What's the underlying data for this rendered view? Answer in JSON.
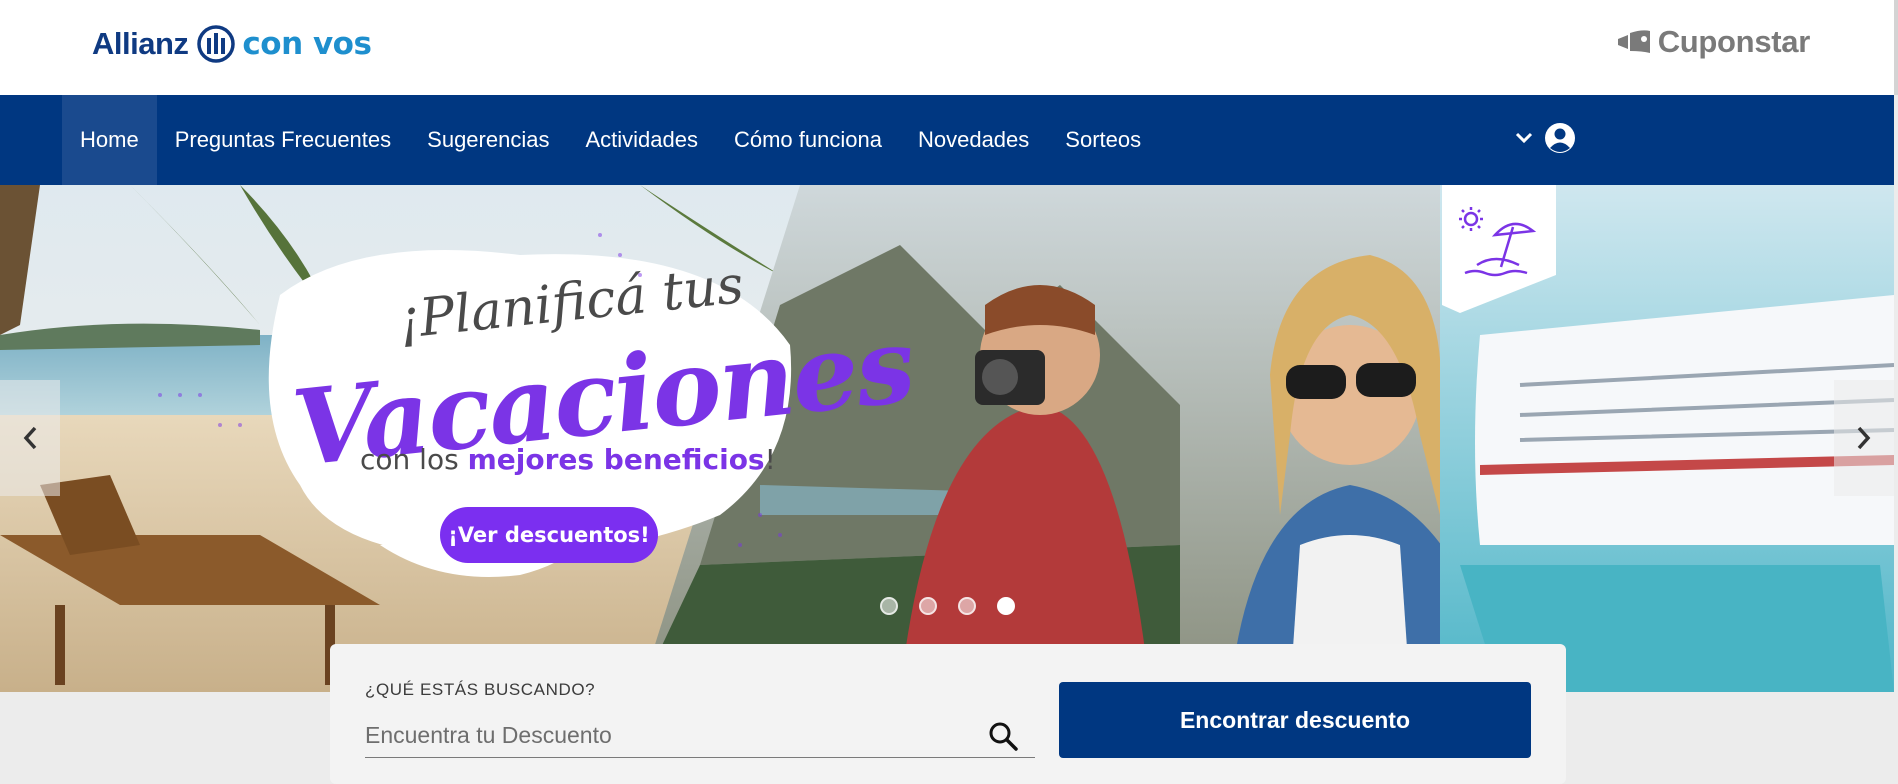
{
  "header": {
    "brand_allianz": "Allianz",
    "brand_convos": "con vos",
    "partner": "Cuponstar"
  },
  "nav": {
    "items": [
      {
        "label": "Home",
        "active": true
      },
      {
        "label": "Preguntas Frecuentes"
      },
      {
        "label": "Sugerencias"
      },
      {
        "label": "Actividades"
      },
      {
        "label": "Cómo funciona"
      },
      {
        "label": "Novedades"
      },
      {
        "label": "Sorteos"
      }
    ],
    "dropdown_icon": "chevron-down-icon",
    "account_icon": "user-circle-icon"
  },
  "hero": {
    "title_line1": "¡Planificá tus",
    "title_line2": "Vacaciones",
    "subtitle_prefix": "con los",
    "subtitle_bold": "mejores beneficios",
    "subtitle_suffix": "!",
    "cta": "¡Ver descuentos!",
    "slides": 4,
    "active_slide": 4,
    "badge_icon": "beach-umbrella-icon"
  },
  "search": {
    "label": "¿QUÉ ESTÁS BUSCANDO?",
    "placeholder": "Encuentra tu Descuento",
    "value": "",
    "button": "Encontrar descuento"
  },
  "colors": {
    "brand_navy": "#003781",
    "brand_blue": "#1e8fce",
    "accent_purple": "#7b2ff0"
  }
}
